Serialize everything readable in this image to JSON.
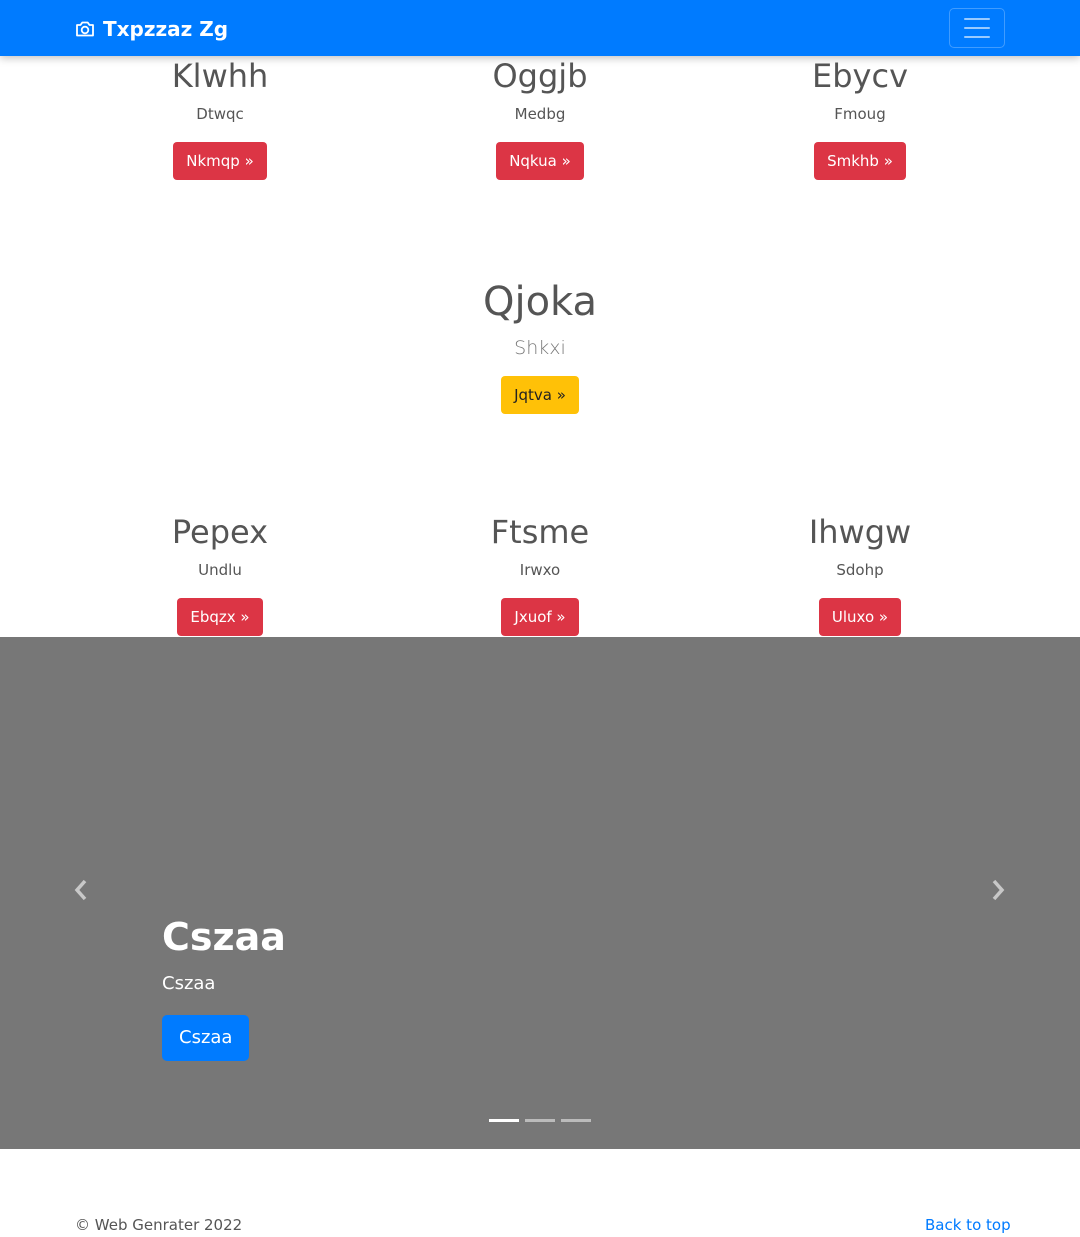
{
  "navbar": {
    "brand_icon": "camera-icon",
    "brand": "Txpzzaz Zg",
    "toggler_icon": "hamburger-menu-icon",
    "color": "#007bff"
  },
  "features_top": [
    {
      "title": "Klwhh",
      "text": "Dtwqc",
      "button": "Nkmqp »"
    },
    {
      "title": "Oggjb",
      "text": "Medbg",
      "button": "Nqkua »"
    },
    {
      "title": "Ebycv",
      "text": "Fmoug",
      "button": "Smkhb »"
    }
  ],
  "hero": {
    "title": "Qjoka",
    "text": "Shkxi",
    "button": "Jqtva »"
  },
  "features_bottom": [
    {
      "title": "Pepex",
      "text": "Undlu",
      "button": "Ebqzx »"
    },
    {
      "title": "Ftsme",
      "text": "Irwxo",
      "button": "Jxuof »"
    },
    {
      "title": "Ihwgw",
      "text": "Sdohp",
      "button": "Uluxo »"
    }
  ],
  "carousel": {
    "background": "#777777",
    "caption_title": "Cszaa",
    "caption_text": "Cszaa",
    "caption_button": "Cszaa",
    "prev_icon": "chevron-left-icon",
    "next_icon": "chevron-right-icon",
    "slide_count": 3,
    "active_slide": 1
  },
  "footer": {
    "copyright": "© Web Genrater 2022",
    "back_to_top": "Back to top"
  },
  "colors": {
    "primary": "#007bff",
    "danger": "#dc3545",
    "warning": "#ffc107"
  }
}
